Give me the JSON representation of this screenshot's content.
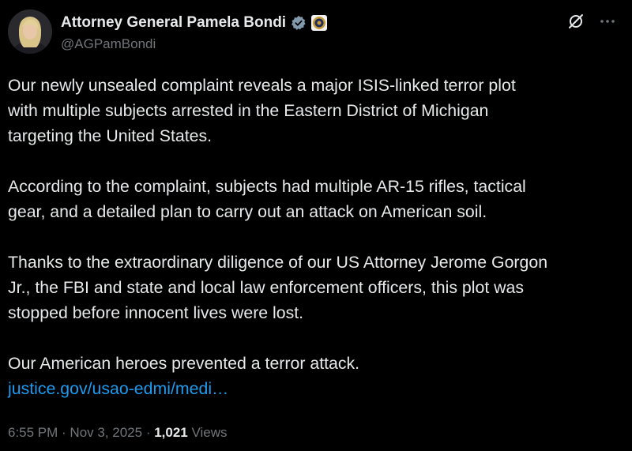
{
  "author": {
    "display_name": "Attorney General Pamela Bondi",
    "handle": "@AGPamBondi",
    "avatar_icon": "profile-photo",
    "verified_icon": "verified-badge-icon",
    "affiliation_icon": "doj-seal-icon",
    "verified_color": "#829aab"
  },
  "actions": {
    "grok_icon": "grok-icon",
    "more_icon": "more-horizontal-icon"
  },
  "tweet": {
    "paragraphs": [
      "Our newly unsealed complaint reveals a major ISIS-linked terror plot\nwith multiple subjects arrested in the Eastern District of Michigan\ntargeting the United States.",
      "According to the complaint, subjects had multiple AR-15 rifles, tactical\ngear, and a detailed plan to carry out an attack on American soil.",
      "Thanks to the extraordinary diligence of our US Attorney Jerome Gorgon\nJr., the FBI and state and local law enforcement officers, this plot was\nstopped before innocent lives were lost.",
      "Our American heroes prevented a terror attack."
    ],
    "link_text": "justice.gov/usao-edmi/medi…",
    "link_color": "#1d9bf0"
  },
  "meta": {
    "time": "6:55 PM",
    "separator1": " · ",
    "date": "Nov 3, 2025",
    "separator2": " · ",
    "views_count": "1,021",
    "views_label": " Views"
  }
}
